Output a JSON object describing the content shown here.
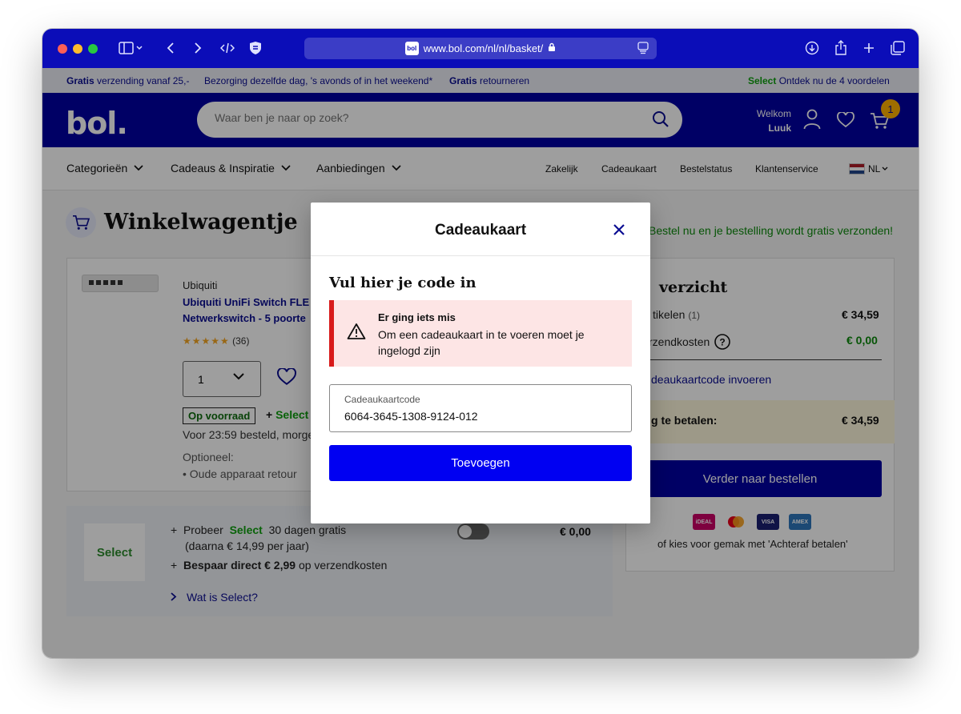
{
  "browser": {
    "url": "www.bol.com/nl/nl/basket/",
    "favicon_text": "bol"
  },
  "usp": {
    "item1_bold": "Gratis",
    "item1_text": "verzending vanaf 25,-",
    "item2_text": "Bezorging dezelfde dag, 's avonds of in het weekend*",
    "item3_bold": "Gratis",
    "item3_text": "retourneren",
    "select_label": "Select",
    "select_text": "Ontdek nu de 4 voordelen"
  },
  "header": {
    "logo": "bol.",
    "search_placeholder": "Waar ben je naar op zoek?",
    "welcome": "Welkom",
    "user_name": "Luuk",
    "cart_count": "1"
  },
  "nav": {
    "items": [
      "Categorieën",
      "Cadeaus & Inspiratie",
      "Aanbiedingen"
    ],
    "links": [
      "Zakelijk",
      "Cadeaukaart",
      "Bestelstatus",
      "Klantenservice"
    ],
    "language": "NL"
  },
  "page": {
    "title": "Winkelwagentje",
    "free_shipping": "Bestel nu en je bestelling wordt gratis verzonden!"
  },
  "product": {
    "brand": "Ubiquiti",
    "title_line1": "Ubiquiti UniFi Switch FLE",
    "title_line2": "Netwerkswitch - 5 poorte",
    "rating_count": "(36)",
    "rating": 4.5,
    "quantity": "1",
    "stock": "Op voorraad",
    "plus_select_prefix": "+",
    "plus_select": "Select",
    "order_before": "Voor 23:59 besteld, morge",
    "optional": "Optioneel:",
    "retour": "Oude apparaat retour"
  },
  "select_offer": {
    "logo": "Select",
    "try_prefix": "Probeer",
    "try_brand": "Select",
    "try_suffix": "30 dagen gratis",
    "after": "(daarna € 14,99 per jaar)",
    "save_bold": "Bespaar direct € 2,99",
    "save_suffix": "op verzendkosten",
    "price": "€ 0,00",
    "what_is": "Wat is Select?"
  },
  "summary": {
    "title": "verzicht",
    "articles_label": "tikelen",
    "articles_count": "(1)",
    "articles_value": "€ 34,59",
    "shipping_label": "rzendkosten",
    "shipping_value": "€ 0,00",
    "giftcard_link": "deaukaartcode invoeren",
    "to_pay_label": "g te betalen:",
    "to_pay_value": "€ 34,59",
    "checkout_button": "Verder naar bestellen",
    "achteraf": "of kies voor gemak met 'Achteraf betalen'"
  },
  "modal": {
    "title": "Cadeaukaart",
    "subtitle": "Vul hier je code in",
    "error_title": "Er ging iets mis",
    "error_message": "Om een cadeaukaart in te voeren moet je ingelogd zijn",
    "field_label": "Cadeaukaartcode",
    "field_value": "6064-3645-1308-9124-012",
    "add_button": "Toevoegen"
  },
  "colors": {
    "brand_blue": "#0000a4",
    "button_blue": "#0000f2",
    "error_red": "#d81b1b",
    "select_green": "#10a010",
    "badge_yellow": "#ffb000"
  }
}
